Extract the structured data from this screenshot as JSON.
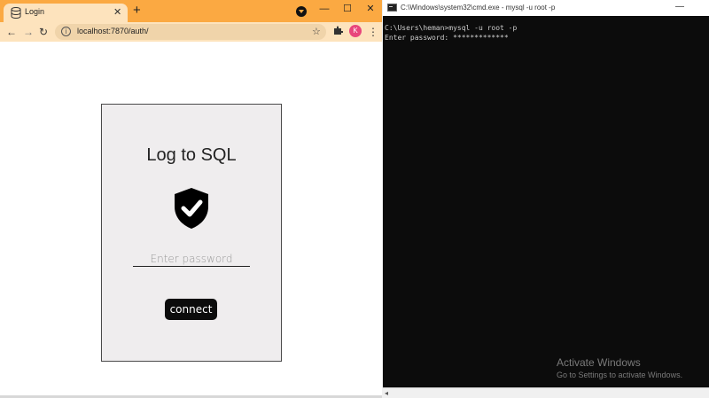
{
  "browser": {
    "tab": {
      "title": "Login",
      "close_glyph": "✕",
      "favicon": "database-icon"
    },
    "new_tab_glyph": "+",
    "window_controls": {
      "minimize": "—",
      "maximize": "☐",
      "close": "✕"
    },
    "nav": {
      "back": "←",
      "forward": "→",
      "reload": "↻"
    },
    "address": "localhost:7870/auth/",
    "star_glyph": "☆",
    "avatar_letter": "K",
    "menu_glyph": "⋮",
    "accent_color": "#fba942"
  },
  "login": {
    "title": "Log to SQL",
    "password_placeholder": "Enter password",
    "password_value": "",
    "connect_label": "connect",
    "icon": "shield-check-icon"
  },
  "cmd": {
    "title": "C:\\Windows\\system32\\cmd.exe - mysql  -u root -p",
    "minimize": "—",
    "lines": [
      "C:\\Users\\heman>mysql -u root -p",
      "Enter password: *************"
    ],
    "scroll_left": "◂"
  },
  "watermark": {
    "title": "Activate Windows",
    "subtitle": "Go to Settings to activate Windows."
  }
}
